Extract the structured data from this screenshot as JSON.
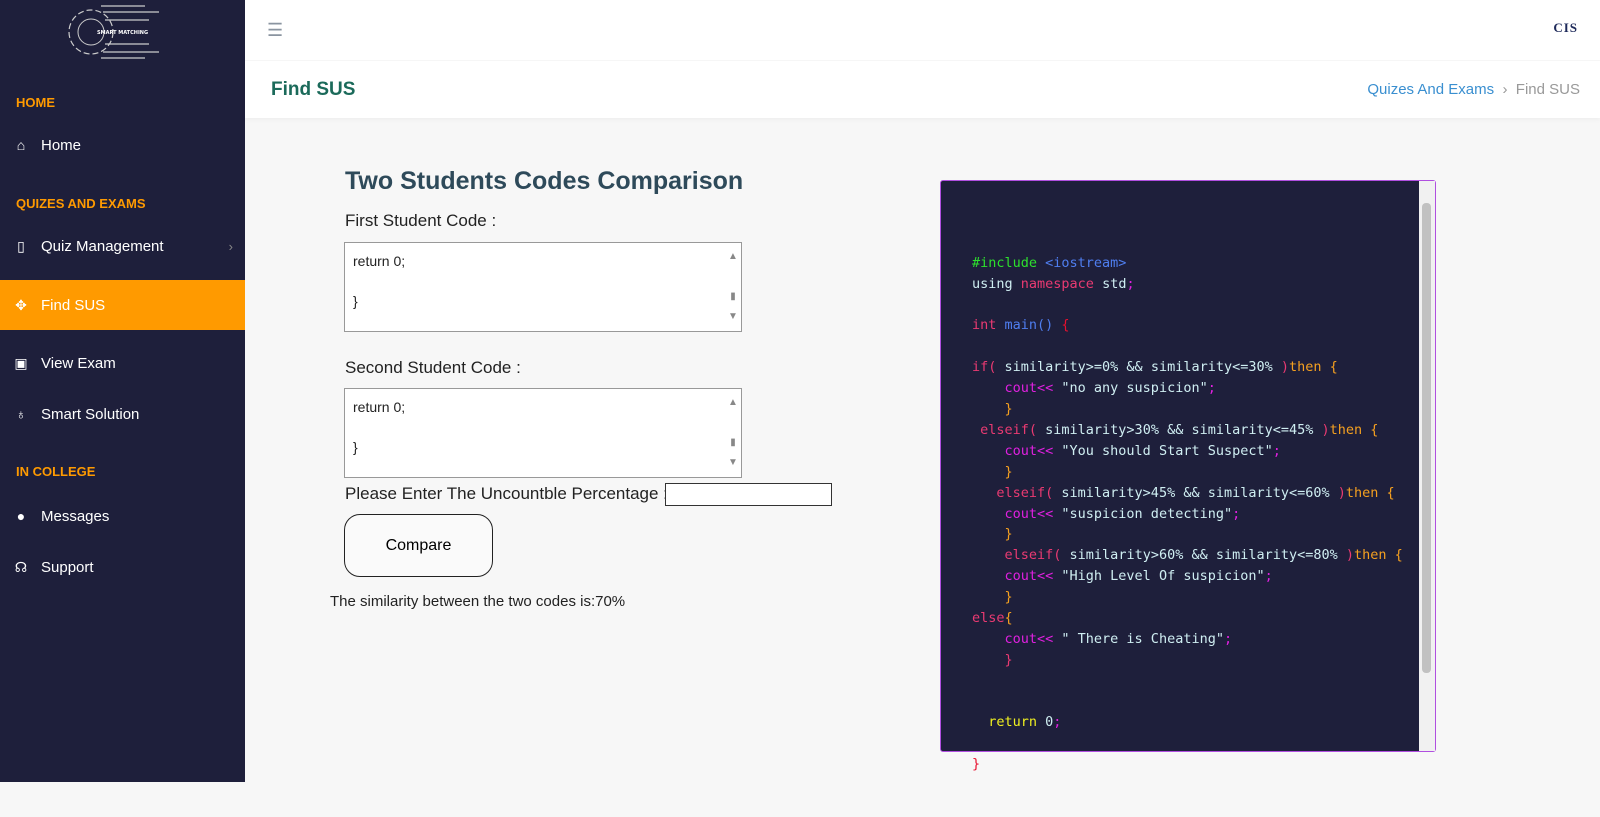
{
  "sidebar": {
    "logo_text": "SMART MATCHING",
    "sections": [
      {
        "label": "HOME"
      },
      {
        "label": "QUIZES AND EXAMS"
      },
      {
        "label": "IN COLLEGE"
      }
    ],
    "items": [
      {
        "label": "Home",
        "icon": "home-icon"
      },
      {
        "label": "Quiz Management",
        "icon": "file-code-icon"
      },
      {
        "label": "Find SUS",
        "icon": "crosshair-icon",
        "active": true
      },
      {
        "label": "View Exam",
        "icon": "file-excel-icon"
      },
      {
        "label": "Smart Solution",
        "icon": "lightbulb-icon"
      },
      {
        "label": "Messages",
        "icon": "chat-icon"
      },
      {
        "label": "Support",
        "icon": "headset-icon"
      }
    ],
    "accent": "#ff9a00",
    "bg": "#1e1f3b"
  },
  "topbar": {
    "brand": "CIS"
  },
  "header": {
    "title": "Find SUS",
    "breadcrumb": [
      "Quizes And Exams",
      "Find SUS"
    ]
  },
  "main": {
    "heading": "Two Students Codes Comparison",
    "first_label": "First Student Code :",
    "first_value": "return 0;\n\n}",
    "second_label": "Second Student Code :",
    "second_value": "return 0;\n\n}",
    "percent_label": "Please Enter The Uncountble Percentage :",
    "percent_value": "",
    "compare": "Compare",
    "result": "The similarity between the two codes is:70%"
  },
  "code": [
    [
      [
        "#include ",
        "g"
      ],
      [
        "<iostream>",
        "b"
      ]
    ],
    [
      [
        "using ",
        "t"
      ],
      [
        "namespace",
        "k"
      ],
      [
        " std",
        "t"
      ],
      [
        ";",
        "m"
      ]
    ],
    [],
    [
      [
        "int ",
        "k"
      ],
      [
        "main() ",
        "b"
      ],
      [
        "{",
        "r"
      ]
    ],
    [],
    [
      [
        "if( ",
        "k"
      ],
      [
        "similarity>=0% && similarity<=30% ",
        "t"
      ],
      [
        ")",
        "k"
      ],
      [
        "then {",
        "o"
      ]
    ],
    [
      [
        "    cout<< ",
        "m"
      ],
      [
        "\"no any suspicion\"",
        "t"
      ],
      [
        ";",
        "m"
      ]
    ],
    [
      [
        "    }",
        "o"
      ]
    ],
    [
      [
        " elseif( ",
        "k"
      ],
      [
        "similarity>30% && similarity<=45% ",
        "t"
      ],
      [
        ")",
        "k"
      ],
      [
        "then {",
        "o"
      ]
    ],
    [
      [
        "    cout<< ",
        "m"
      ],
      [
        "\"You should Start Suspect\"",
        "t"
      ],
      [
        ";",
        "m"
      ]
    ],
    [
      [
        "    }",
        "o"
      ]
    ],
    [
      [
        "   elseif( ",
        "k"
      ],
      [
        "similarity>45% && similarity<=60% ",
        "t"
      ],
      [
        ")",
        "k"
      ],
      [
        "then {",
        "o"
      ]
    ],
    [
      [
        "    cout<< ",
        "m"
      ],
      [
        "\"suspicion detecting\"",
        "t"
      ],
      [
        ";",
        "m"
      ]
    ],
    [
      [
        "    }",
        "o"
      ]
    ],
    [
      [
        "    elseif( ",
        "k"
      ],
      [
        "similarity>60% && similarity<=80% ",
        "t"
      ],
      [
        ")",
        "k"
      ],
      [
        "then {",
        "o"
      ]
    ],
    [
      [
        "    cout<< ",
        "m"
      ],
      [
        "\"High Level Of suspicion\"",
        "t"
      ],
      [
        ";",
        "m"
      ]
    ],
    [
      [
        "    }",
        "o"
      ]
    ],
    [
      [
        "else",
        "k"
      ],
      [
        "{",
        "o"
      ]
    ],
    [
      [
        "    cout<< ",
        "m"
      ],
      [
        "\" There is Cheating\"",
        "t"
      ],
      [
        ";",
        "m"
      ]
    ],
    [
      [
        "    }",
        "k"
      ]
    ],
    [],
    [],
    [
      [
        "  return ",
        "y"
      ],
      [
        "0",
        "t"
      ],
      [
        ";",
        "m"
      ]
    ],
    [],
    [
      [
        "}",
        "r"
      ]
    ]
  ]
}
